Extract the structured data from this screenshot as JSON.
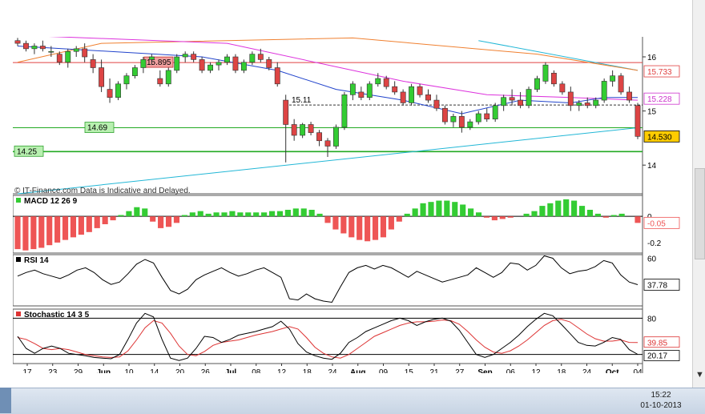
{
  "window": {
    "time": "15:22",
    "date": "01-10-2013"
  },
  "chart_data": {
    "type": "candlestick",
    "source_text": "© IT-Finance.com   Data is Indicative and Delayed.",
    "price": {
      "yticks": [
        16,
        15,
        14
      ],
      "ylim": [
        13.47,
        16.37
      ],
      "hlines": [
        {
          "label": "15.895",
          "value": 15.895,
          "color": "#e04040"
        },
        {
          "label": "15.11",
          "value": 15.11,
          "color": "#333333"
        },
        {
          "label": "14.69",
          "value": 14.69,
          "color": "#22aa22"
        },
        {
          "label": "14.25",
          "value": 14.25,
          "color": "#22aa22"
        }
      ],
      "right_labels": [
        {
          "text": "15.733",
          "value": 15.733,
          "color": "#e04040"
        },
        {
          "text": "15.228",
          "value": 15.228,
          "color": "#cc33cc"
        },
        {
          "text": "14.530",
          "value": 14.53,
          "color": "#000000"
        }
      ],
      "candles": [
        [
          16.3,
          16.35,
          16.2,
          16.25
        ],
        [
          16.25,
          16.3,
          16.1,
          16.15
        ],
        [
          16.15,
          16.25,
          16.05,
          16.2
        ],
        [
          16.2,
          16.3,
          16.1,
          16.15
        ],
        [
          16.1,
          16.2,
          16.0,
          16.1
        ],
        [
          16.05,
          16.1,
          15.85,
          15.9
        ],
        [
          15.9,
          16.15,
          15.8,
          16.1
        ],
        [
          16.1,
          16.2,
          16.0,
          16.15
        ],
        [
          16.15,
          16.25,
          15.9,
          16.0
        ],
        [
          15.95,
          16.05,
          15.7,
          15.8
        ],
        [
          15.8,
          15.95,
          15.35,
          15.45
        ],
        [
          15.4,
          15.6,
          15.15,
          15.25
        ],
        [
          15.25,
          15.55,
          15.2,
          15.5
        ],
        [
          15.5,
          15.7,
          15.4,
          15.65
        ],
        [
          15.65,
          15.85,
          15.6,
          15.8
        ],
        [
          15.8,
          16.0,
          15.7,
          15.95
        ],
        [
          15.95,
          16.05,
          15.85,
          16.0
        ],
        [
          15.6,
          15.75,
          15.45,
          15.5
        ],
        [
          15.5,
          15.8,
          15.45,
          15.75
        ],
        [
          15.75,
          16.05,
          15.7,
          16.0
        ],
        [
          16.0,
          16.1,
          15.9,
          16.05
        ],
        [
          16.05,
          16.1,
          15.9,
          15.95
        ],
        [
          15.95,
          16.0,
          15.7,
          15.75
        ],
        [
          15.75,
          15.9,
          15.7,
          15.85
        ],
        [
          15.85,
          15.95,
          15.75,
          15.9
        ],
        [
          15.9,
          16.05,
          15.85,
          16.0
        ],
        [
          16.0,
          16.05,
          15.7,
          15.75
        ],
        [
          15.75,
          15.95,
          15.7,
          15.9
        ],
        [
          15.9,
          16.1,
          15.85,
          16.05
        ],
        [
          16.05,
          16.15,
          15.9,
          15.95
        ],
        [
          15.95,
          16.0,
          15.75,
          15.8
        ],
        [
          15.8,
          15.9,
          15.45,
          15.5
        ],
        [
          15.2,
          15.3,
          14.05,
          14.75
        ],
        [
          14.75,
          14.85,
          14.45,
          14.55
        ],
        [
          14.55,
          14.78,
          14.5,
          14.75
        ],
        [
          14.75,
          14.8,
          14.55,
          14.6
        ],
        [
          14.6,
          14.65,
          14.35,
          14.45
        ],
        [
          14.45,
          14.5,
          14.15,
          14.35
        ],
        [
          14.35,
          14.75,
          14.3,
          14.7
        ],
        [
          14.7,
          15.35,
          14.65,
          15.3
        ],
        [
          15.3,
          15.55,
          15.2,
          15.5
        ],
        [
          15.35,
          15.45,
          15.2,
          15.25
        ],
        [
          15.25,
          15.55,
          15.2,
          15.5
        ],
        [
          15.5,
          15.7,
          15.45,
          15.6
        ],
        [
          15.6,
          15.65,
          15.4,
          15.45
        ],
        [
          15.45,
          15.55,
          15.3,
          15.35
        ],
        [
          15.35,
          15.4,
          15.1,
          15.15
        ],
        [
          15.15,
          15.5,
          15.1,
          15.45
        ],
        [
          15.45,
          15.5,
          15.25,
          15.3
        ],
        [
          15.3,
          15.4,
          15.15,
          15.2
        ],
        [
          15.2,
          15.3,
          15.0,
          15.05
        ],
        [
          15.05,
          15.1,
          14.75,
          14.8
        ],
        [
          14.8,
          14.95,
          14.7,
          14.9
        ],
        [
          14.9,
          15.0,
          14.6,
          14.7
        ],
        [
          14.7,
          14.85,
          14.65,
          14.8
        ],
        [
          14.8,
          15.0,
          14.75,
          14.95
        ],
        [
          14.95,
          15.05,
          14.8,
          14.85
        ],
        [
          14.85,
          15.15,
          14.8,
          15.1
        ],
        [
          15.1,
          15.3,
          15.0,
          15.25
        ],
        [
          15.25,
          15.4,
          15.1,
          15.2
        ],
        [
          15.2,
          15.35,
          15.05,
          15.1
        ],
        [
          15.1,
          15.45,
          15.05,
          15.4
        ],
        [
          15.4,
          15.65,
          15.35,
          15.6
        ],
        [
          15.55,
          15.9,
          15.5,
          15.85
        ],
        [
          15.7,
          15.75,
          15.45,
          15.5
        ],
        [
          15.5,
          15.55,
          15.3,
          15.35
        ],
        [
          15.35,
          15.45,
          15.0,
          15.1
        ],
        [
          15.1,
          15.2,
          15.0,
          15.15
        ],
        [
          15.15,
          15.25,
          15.05,
          15.1
        ],
        [
          15.1,
          15.25,
          15.05,
          15.2
        ],
        [
          15.2,
          15.6,
          15.15,
          15.55
        ],
        [
          15.55,
          15.75,
          15.45,
          15.65
        ],
        [
          15.65,
          15.7,
          15.3,
          15.35
        ],
        [
          15.35,
          15.45,
          15.15,
          15.2
        ],
        [
          15.1,
          15.15,
          14.48,
          14.53
        ]
      ],
      "ma_blue": [
        [
          0,
          16.2
        ],
        [
          22,
          16.0
        ],
        [
          31,
          15.75
        ],
        [
          38,
          15.4
        ],
        [
          46,
          15.2
        ],
        [
          53,
          14.95
        ],
        [
          60,
          15.2
        ],
        [
          66,
          15.15
        ],
        [
          70,
          15.25
        ],
        [
          74,
          15.25
        ]
      ],
      "ma_magenta": [
        [
          0,
          16.4
        ],
        [
          25,
          16.25
        ],
        [
          37,
          15.85
        ],
        [
          46,
          15.55
        ],
        [
          56,
          15.3
        ],
        [
          66,
          15.25
        ],
        [
          74,
          15.2
        ]
      ],
      "ma_orange": [
        [
          0,
          15.9
        ],
        [
          10,
          16.25
        ],
        [
          40,
          16.35
        ],
        [
          62,
          16.05
        ],
        [
          74,
          15.75
        ]
      ],
      "trend_cyan": [
        [
          0,
          13.47
        ],
        [
          74,
          14.69
        ]
      ],
      "trend_cyan2": [
        [
          55,
          16.3
        ],
        [
          74,
          15.75
        ]
      ]
    },
    "macd": {
      "label": "MACD 12 26 9",
      "yticks": [
        0,
        -0.2
      ],
      "ylim": [
        -0.28,
        0.16
      ],
      "right_label": "-0.05",
      "values": [
        -0.25,
        -0.26,
        -0.25,
        -0.24,
        -0.22,
        -0.2,
        -0.18,
        -0.16,
        -0.14,
        -0.12,
        -0.09,
        -0.06,
        -0.03,
        0.01,
        0.04,
        0.07,
        0.06,
        -0.04,
        -0.09,
        -0.08,
        -0.05,
        0.01,
        0.03,
        0.04,
        0.02,
        0.03,
        0.03,
        0.04,
        0.03,
        0.03,
        0.03,
        0.03,
        0.04,
        0.04,
        0.05,
        0.06,
        0.06,
        0.05,
        0.02,
        -0.05,
        -0.1,
        -0.13,
        -0.16,
        -0.18,
        -0.19,
        -0.18,
        -0.16,
        -0.1,
        -0.04,
        0.02,
        0.06,
        0.1,
        0.11,
        0.12,
        0.12,
        0.11,
        0.09,
        0.06,
        0.03,
        -0.01,
        -0.03,
        -0.02,
        -0.01,
        0.0,
        0.02,
        0.04,
        0.08,
        0.1,
        0.12,
        0.13,
        0.12,
        0.08,
        0.05,
        0.02,
        -0.01,
        0.01,
        0.02,
        0.0,
        -0.05
      ]
    },
    "rsi": {
      "label": "RSI 14",
      "yticks": [
        60
      ],
      "ylim": [
        20,
        63
      ],
      "right_label": "37.78",
      "values": [
        45,
        48,
        50,
        47,
        45,
        43,
        46,
        50,
        52,
        48,
        42,
        38,
        40,
        47,
        55,
        59,
        56,
        44,
        33,
        30,
        34,
        42,
        46,
        49,
        52,
        48,
        45,
        47,
        50,
        52,
        48,
        44,
        26,
        25,
        30,
        26,
        24,
        23,
        36,
        48,
        52,
        54,
        51,
        54,
        52,
        48,
        44,
        49,
        46,
        43,
        40,
        42,
        44,
        46,
        52,
        48,
        44,
        48,
        56,
        55,
        50,
        54,
        62,
        60,
        52,
        47,
        49,
        50,
        53,
        58,
        56,
        46,
        40,
        37.78
      ]
    },
    "stoch": {
      "label": "Stochastic 14 3 5",
      "yticks": [
        80,
        20
      ],
      "ylim": [
        5,
        95
      ],
      "right_labels": [
        "39.85",
        "20.17"
      ],
      "k": [
        50,
        30,
        22,
        30,
        34,
        30,
        22,
        20,
        18,
        15,
        14,
        13,
        20,
        45,
        72,
        88,
        82,
        45,
        14,
        10,
        14,
        30,
        50,
        48,
        40,
        45,
        52,
        55,
        58,
        62,
        66,
        75,
        62,
        38,
        24,
        18,
        14,
        12,
        22,
        40,
        48,
        58,
        64,
        70,
        76,
        80,
        76,
        68,
        74,
        78,
        80,
        75,
        60,
        40,
        20,
        15,
        20,
        30,
        40,
        52,
        66,
        78,
        88,
        84,
        70,
        55,
        40,
        35,
        34,
        40,
        48,
        45,
        28,
        20.17
      ],
      "d": [
        48,
        45,
        38,
        30,
        28,
        30,
        28,
        24,
        20,
        18,
        16,
        15,
        16,
        26,
        44,
        64,
        76,
        72,
        55,
        34,
        20,
        18,
        25,
        35,
        40,
        42,
        44,
        48,
        52,
        55,
        58,
        62,
        66,
        62,
        48,
        32,
        22,
        16,
        14,
        20,
        30,
        40,
        50,
        56,
        62,
        68,
        72,
        74,
        74,
        75,
        77,
        76,
        70,
        58,
        44,
        32,
        24,
        22,
        26,
        34,
        44,
        56,
        68,
        76,
        78,
        74,
        64,
        54,
        46,
        42,
        42,
        44,
        40,
        39.85
      ]
    },
    "x_ticks": [
      "17",
      "23",
      "29",
      "Jun",
      "10",
      "14",
      "20",
      "26",
      "Jul",
      "08",
      "12",
      "18",
      "24",
      "Aug",
      "09",
      "15",
      "21",
      "27",
      "Sep",
      "06",
      "12",
      "18",
      "24",
      "Oct",
      "04"
    ],
    "x_bold": [
      "Jun",
      "Jul",
      "Aug",
      "Sep",
      "Oct"
    ]
  }
}
